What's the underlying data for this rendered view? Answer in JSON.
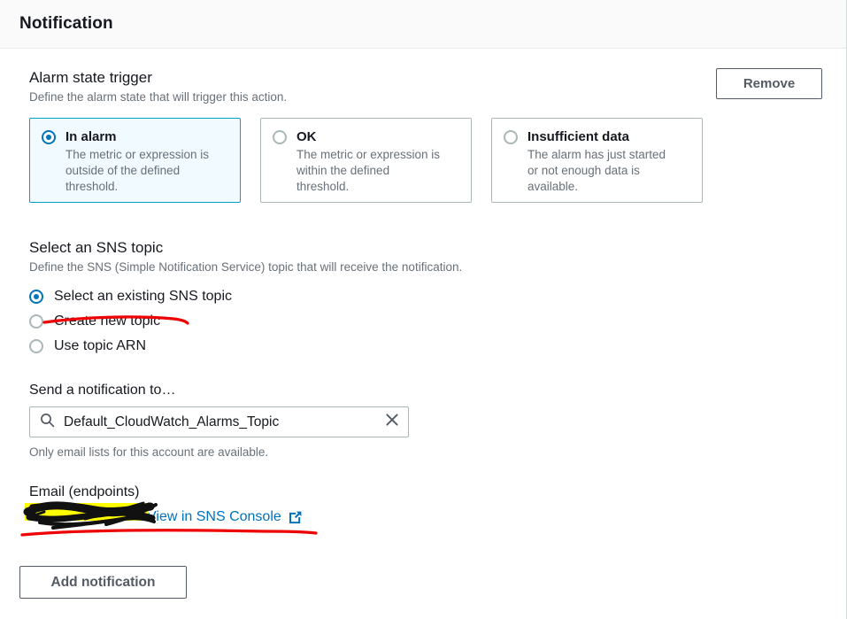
{
  "panel": {
    "title": "Notification"
  },
  "alarm_state_trigger": {
    "heading": "Alarm state trigger",
    "description": "Define the alarm state that will trigger this action.",
    "remove_label": "Remove",
    "options": [
      {
        "label": "In alarm",
        "description": "The metric or expression is outside of the defined threshold.",
        "selected": true
      },
      {
        "label": "OK",
        "description": "The metric or expression is within the defined threshold.",
        "selected": false
      },
      {
        "label": "Insufficient data",
        "description": "The alarm has just started or not enough data is available.",
        "selected": false
      }
    ]
  },
  "sns_topic": {
    "heading": "Select an SNS topic",
    "description": "Define the SNS (Simple Notification Service) topic that will receive the notification.",
    "options": [
      {
        "label": "Select an existing SNS topic",
        "selected": true
      },
      {
        "label": "Create new topic",
        "selected": false
      },
      {
        "label": "Use topic ARN",
        "selected": false
      }
    ]
  },
  "send_to": {
    "label": "Send a notification to…",
    "search_value": "Default_CloudWatch_Alarms_Topic",
    "search_placeholder": "Search",
    "hint": "Only email lists for this account are available."
  },
  "email_endpoints": {
    "label": "Email (endpoints)",
    "endpoint_value": "",
    "link_label": "View in SNS Console"
  },
  "footer": {
    "add_notification_label": "Add notification"
  },
  "colors": {
    "accent_blue": "#0073bb",
    "selected_tile_border": "#00a1c9",
    "selected_tile_bg": "#f1faff",
    "border_gray": "#aab7b8",
    "text_dark": "#16191f",
    "text_muted": "#687078",
    "button_text": "#545b64",
    "annotation_red": "#ee0000",
    "annotation_yellow": "#ffff00",
    "annotation_black": "#111111"
  }
}
